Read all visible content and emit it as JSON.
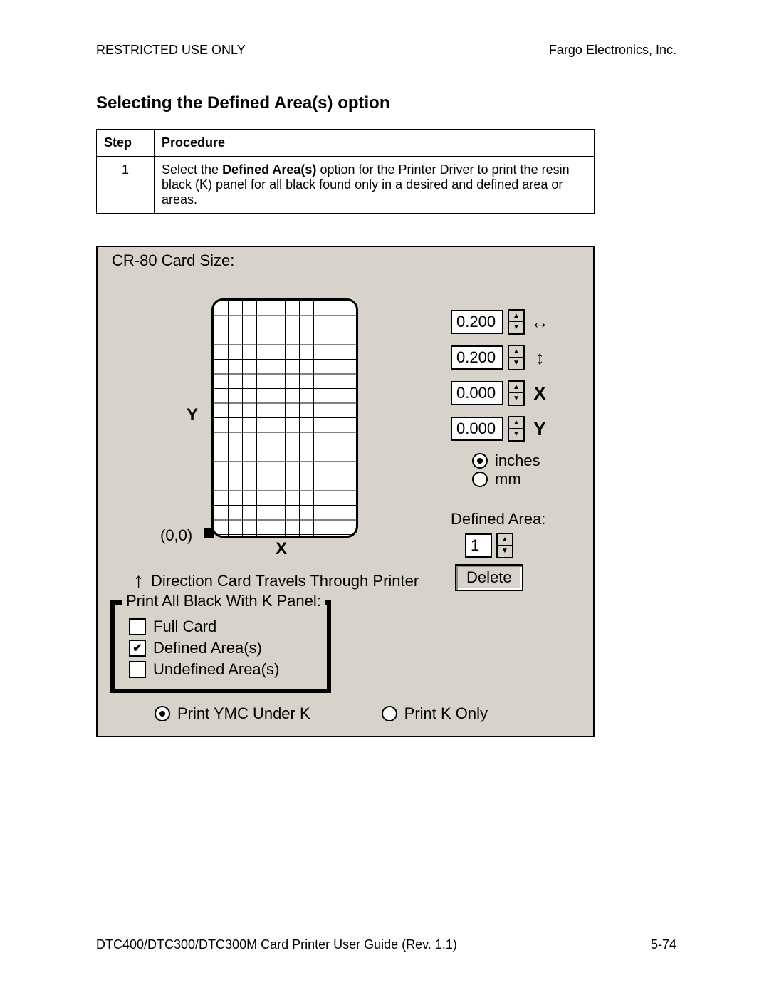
{
  "header": {
    "left": "RESTRICTED USE ONLY",
    "right": "Fargo Electronics, Inc."
  },
  "section_title": "Selecting the Defined Area(s) option",
  "table": {
    "head_step": "Step",
    "head_proc": "Procedure",
    "row1_step": "1",
    "row1_pre": "Select the ",
    "row1_bold": "Defined Area(s)",
    "row1_post": " option for the Printer Driver to print the resin black (K) panel for all black found only in a desired and defined area or areas."
  },
  "dialog": {
    "title": "CR-80 Card Size:",
    "axes": {
      "y": "Y",
      "x": "X",
      "origin": "(0,0)"
    },
    "direction": "Direction Card Travels Through Printer",
    "spinners": {
      "width": {
        "value": "0.200",
        "icon": "↔"
      },
      "height": {
        "value": "0.200",
        "icon": "↕"
      },
      "xpos": {
        "value": "0.000",
        "icon": "X"
      },
      "ypos": {
        "value": "0.000",
        "icon": "Y"
      }
    },
    "units": {
      "inches": "inches",
      "mm": "mm",
      "selected": "inches"
    },
    "defined_area": {
      "label": "Defined Area:",
      "value": "1",
      "delete": "Delete"
    },
    "kpanel": {
      "legend": "Print All Black With K Panel:",
      "full_card": "Full Card",
      "defined": "Defined Area(s)",
      "undefined": "Undefined Area(s)",
      "checked": "defined"
    },
    "bottom_radio": {
      "ymc": "Print YMC Under K",
      "konly": "Print K Only",
      "selected": "ymc"
    }
  },
  "footer": {
    "left": "DTC400/DTC300/DTC300M Card Printer User Guide (Rev. 1.1)",
    "right": "5-74"
  }
}
